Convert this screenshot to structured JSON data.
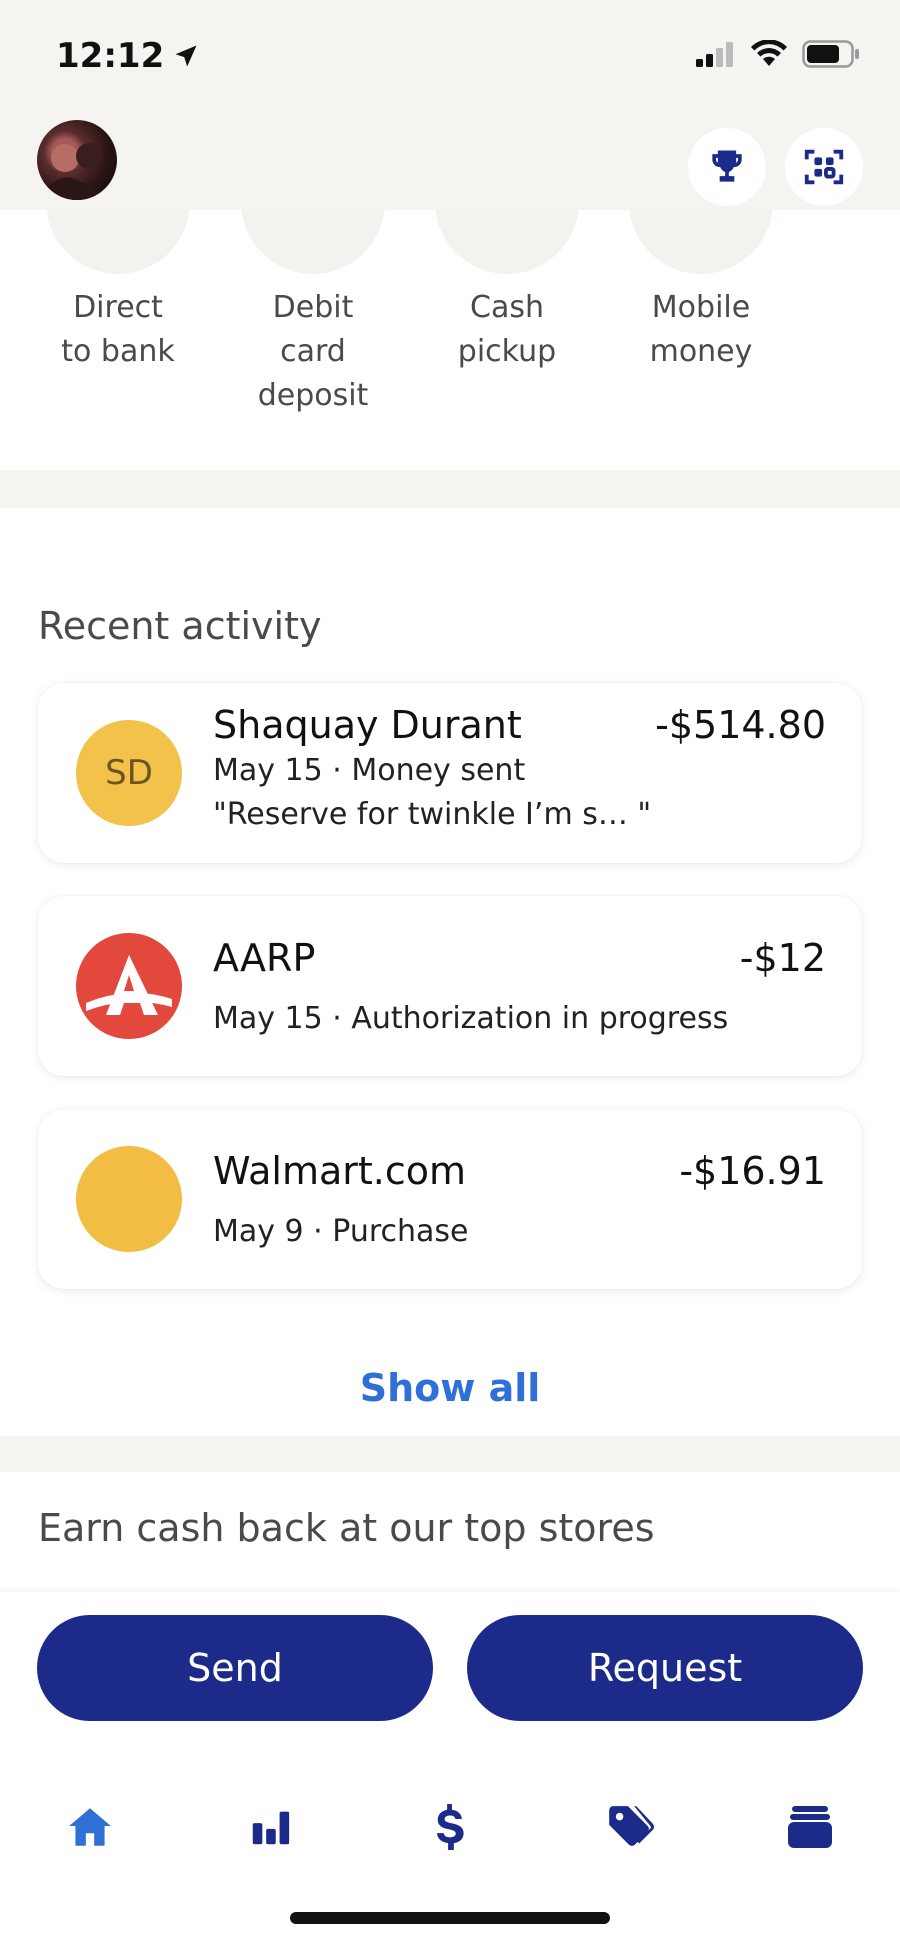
{
  "status_bar": {
    "time": "12:12"
  },
  "header": {
    "avatar_alt": "",
    "trophy_icon": "trophy-icon",
    "scan_icon": "qr-scan-icon"
  },
  "send_methods": [
    {
      "label": "Direct to bank",
      "lines": [
        "Direct",
        "to bank"
      ],
      "accent": "#1c2b8a"
    },
    {
      "label": "Debit card deposit",
      "lines": [
        "Debit",
        "card",
        "deposit"
      ],
      "accent": "#1c2b8a"
    },
    {
      "label": "Cash pickup",
      "lines": [
        "Cash",
        "pickup"
      ],
      "accent": "#8cc7f0"
    },
    {
      "label": "Mobile money",
      "lines": [
        "Mobile",
        "money"
      ],
      "accent": "#1c2b8a"
    }
  ],
  "recent_activity": {
    "title": "Recent activity",
    "items": [
      {
        "initials": "SD",
        "name": "Shaquay Durant",
        "amount": "-$514.80",
        "subtitle": "May 15 · Money sent",
        "note": "\"Reserve for twinkle  I’m s… \"",
        "avatar_color": "#f2c24a"
      },
      {
        "initials": "",
        "name": "AARP",
        "amount": "-$12",
        "subtitle": "May 15 · Authorization in progress",
        "note": "",
        "avatar_color": "#e2483b"
      },
      {
        "initials": "",
        "name": "Walmart.com",
        "amount": "-$16.91",
        "subtitle": "May 9 · Purchase",
        "note": "",
        "avatar_color": "#f2bd42"
      }
    ],
    "show_all": "Show all"
  },
  "earn": {
    "title": "Earn cash back at our top stores"
  },
  "actions": {
    "send": "Send",
    "request": "Request"
  },
  "tab_bar": [
    {
      "name": "home-icon",
      "active": true
    },
    {
      "name": "chart-icon",
      "active": false
    },
    {
      "name": "dollar-icon",
      "active": false
    },
    {
      "name": "offers-tag-icon",
      "active": false
    },
    {
      "name": "wallet-cards-icon",
      "active": false
    }
  ],
  "colors": {
    "primary": "#1c2b8a",
    "link": "#2f6fd6",
    "active_tab": "#2f6fd6"
  }
}
